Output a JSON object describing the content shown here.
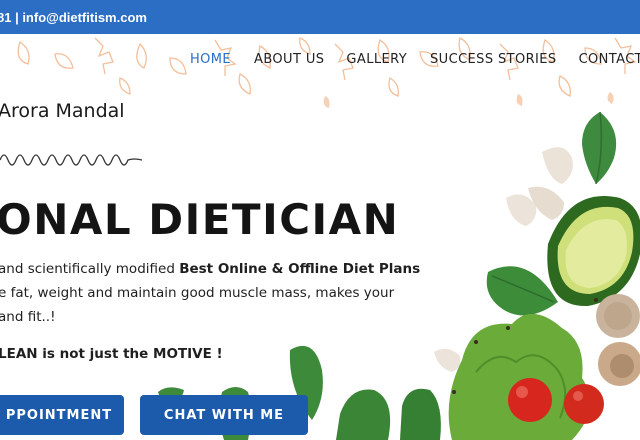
{
  "topbar": {
    "contact": "81 | info@dietfitism.com"
  },
  "nav": {
    "items": [
      "HOME",
      "ABOUT US",
      "GALLERY",
      "SUCCESS STORIES",
      "CONTACT US"
    ]
  },
  "hero": {
    "name": "Arora Mandal",
    "title": "ONAL DIETICIAN",
    "line1_pre": "and scientifically modified ",
    "line1_bold": "Best Online & Offline Diet Plans",
    "line2": "e fat, weight and maintain good muscle mass, makes your",
    "line3": "and fit..!",
    "motive": "LEAN is not just the MOTIVE !"
  },
  "buttons": {
    "appointment": "PPOINTMENT",
    "chat": "CHAT WITH ME"
  },
  "colors": {
    "topbar": "#2b6ec4",
    "nav_active": "#2b6ec4",
    "button": "#1c5aab",
    "leaf_outline": "#f2b48a"
  }
}
